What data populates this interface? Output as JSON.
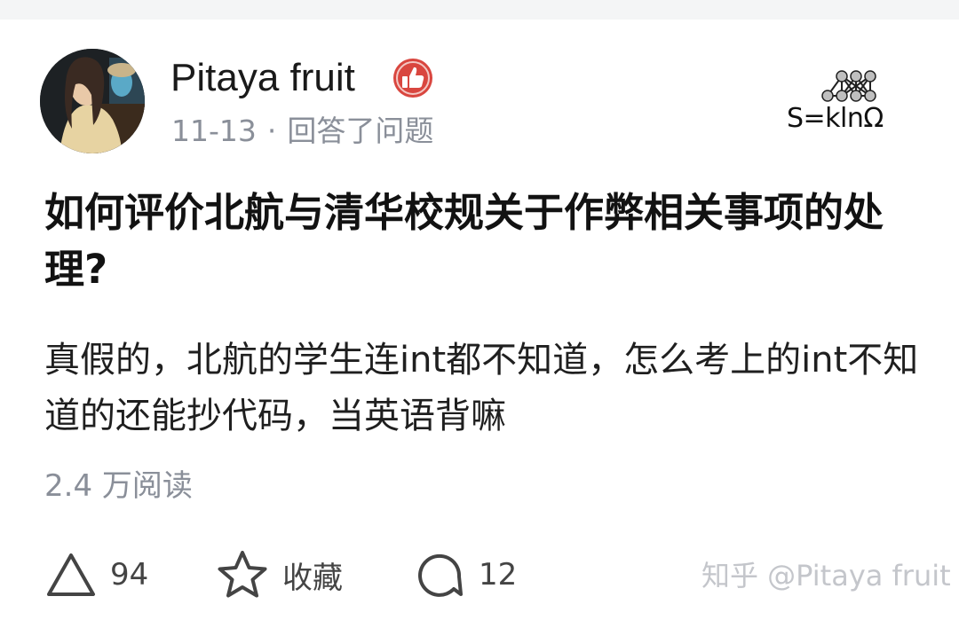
{
  "author": {
    "name": "Pitaya fruit",
    "badge_icon": "thumbs-up-badge-icon"
  },
  "meta": {
    "date": "11-13",
    "separator": "·",
    "action": "回答了问题"
  },
  "logo": {
    "text": "S=klnΩ"
  },
  "question": {
    "title": "如何评价北航与清华校规关于作弊相关事项的处理?"
  },
  "answer": {
    "excerpt": "真假的，北航的学生连int都不知道，怎么考上的int不知道的还能抄代码，当英语背嘛"
  },
  "stats": {
    "read_count": "2.4 万阅读"
  },
  "actions": {
    "upvote_count": "94",
    "favorite_label": "收藏",
    "comment_count": "12"
  },
  "watermark": {
    "text": "知乎 @Pitaya fruit"
  },
  "colors": {
    "badge_red": "#d9463f",
    "meta_gray": "#8a8f99",
    "title_black": "#121212"
  }
}
